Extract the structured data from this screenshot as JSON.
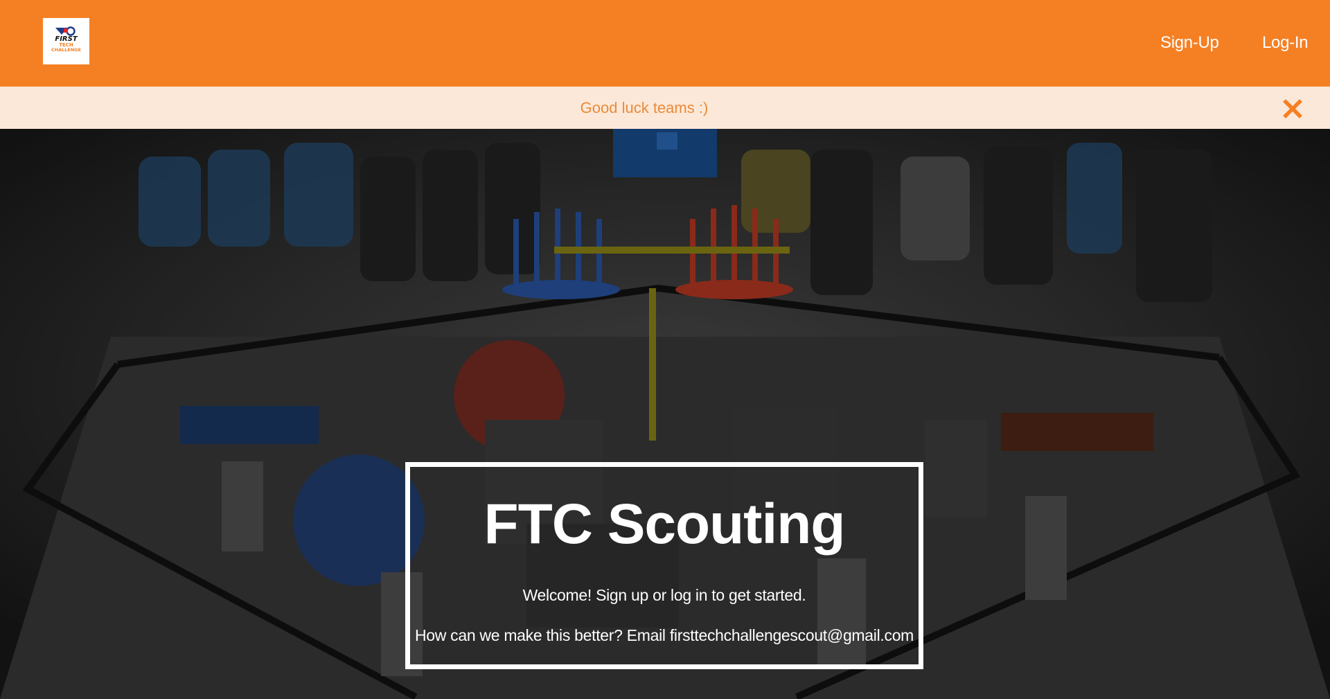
{
  "header": {
    "logo_text": [
      "FIRST",
      "TECH",
      "CHALLENGE"
    ],
    "nav": {
      "signup_label": "Sign-Up",
      "login_label": "Log-In"
    },
    "brand_color": "#f58024"
  },
  "announcement": {
    "text": "Good luck teams :)",
    "close_icon": "close-icon",
    "background_color": "#fce8d8",
    "text_color": "#e98a3a"
  },
  "hero": {
    "title": "FTC Scouting",
    "welcome": "Welcome! Sign up or log in to get started.",
    "feedback": "How can we make this better? Email firsttechchallengescout@gmail.com"
  }
}
